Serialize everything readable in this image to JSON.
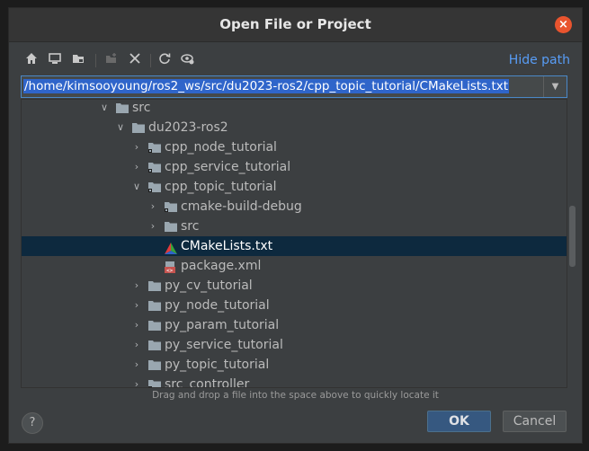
{
  "dialog": {
    "title": "Open File or Project",
    "close_symbol": "×",
    "hide_path_label": "Hide path",
    "path_value": "/home/kimsooyoung/ros2_ws/src/du2023-ros2/cpp_topic_tutorial/CMakeLists.txt",
    "hint": "Drag and drop a file into the space above to quickly locate it",
    "help_label": "?",
    "ok_label": "OK",
    "cancel_label": "Cancel"
  },
  "toolbar": {
    "icons": [
      "home-icon",
      "desktop-icon",
      "project-folder-icon",
      "new-folder-icon",
      "delete-icon",
      "refresh-icon",
      "show-hidden-icon"
    ]
  },
  "tree": {
    "rows": [
      {
        "label": "src",
        "icon": "folder-icon",
        "arrow": "expanded"
      },
      {
        "label": "du2023-ros2",
        "icon": "folder-icon",
        "arrow": "expanded"
      },
      {
        "label": "cpp_node_tutorial",
        "icon": "module-folder-icon",
        "arrow": "collapsed"
      },
      {
        "label": "cpp_service_tutorial",
        "icon": "module-folder-icon",
        "arrow": "collapsed"
      },
      {
        "label": "cpp_topic_tutorial",
        "icon": "module-folder-icon",
        "arrow": "expanded"
      },
      {
        "label": "cmake-build-debug",
        "icon": "module-folder-icon",
        "arrow": "collapsed"
      },
      {
        "label": "src",
        "icon": "folder-icon",
        "arrow": "collapsed"
      },
      {
        "label": "CMakeLists.txt",
        "icon": "cmake-icon",
        "arrow": "none",
        "selected": true
      },
      {
        "label": "package.xml",
        "icon": "xml-file-icon",
        "arrow": "none"
      },
      {
        "label": "py_cv_tutorial",
        "icon": "folder-icon",
        "arrow": "collapsed"
      },
      {
        "label": "py_node_tutorial",
        "icon": "folder-icon",
        "arrow": "collapsed"
      },
      {
        "label": "py_param_tutorial",
        "icon": "folder-icon",
        "arrow": "collapsed"
      },
      {
        "label": "py_service_tutorial",
        "icon": "folder-icon",
        "arrow": "collapsed"
      },
      {
        "label": "py_topic_tutorial",
        "icon": "folder-icon",
        "arrow": "collapsed"
      },
      {
        "label": "src_controller",
        "icon": "module-folder-icon",
        "arrow": "collapsed"
      }
    ]
  },
  "colors": {
    "accent": "#589df6",
    "selection": "#0d293e",
    "path_selection": "#2f65ca",
    "close": "#e9542e",
    "ok_button": "#365880"
  }
}
